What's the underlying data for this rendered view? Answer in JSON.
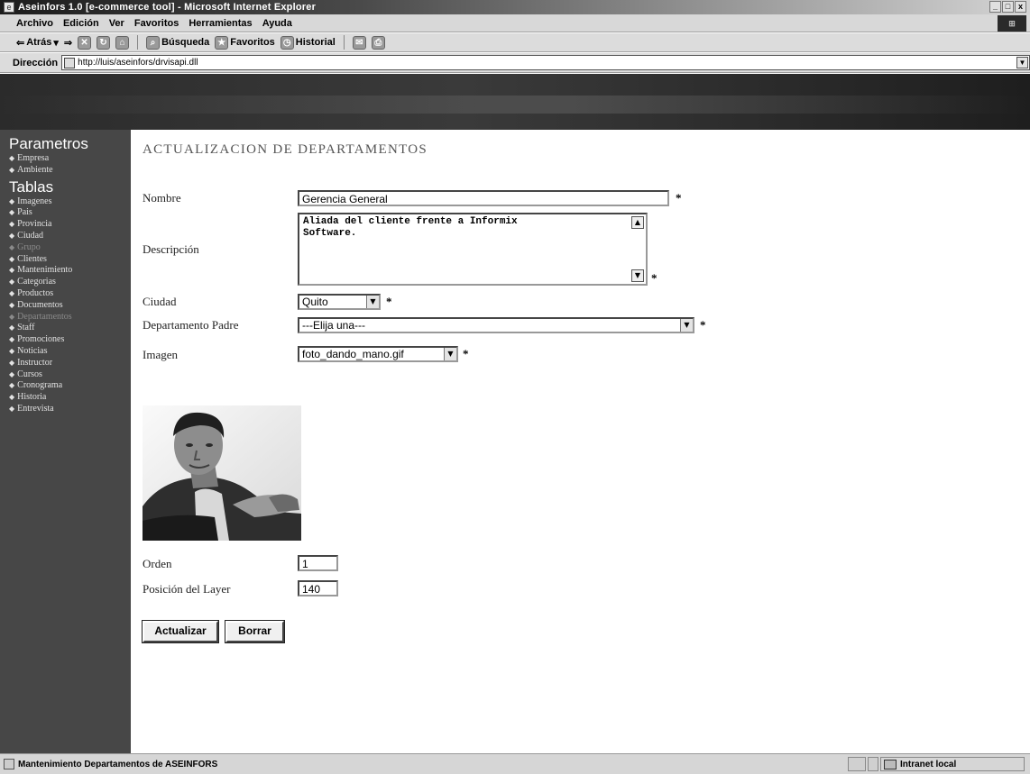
{
  "window": {
    "title": "Aseinfors 1.0 [e-commerce tool] - Microsoft Internet Explorer",
    "min_glyph": "_",
    "max_glyph": "□",
    "close_glyph": "x"
  },
  "menubar": {
    "items": [
      "Archivo",
      "Edición",
      "Ver",
      "Favoritos",
      "Herramientas",
      "Ayuda"
    ]
  },
  "toolbar": {
    "back": "Atrás",
    "search": "Búsqueda",
    "favorites": "Favoritos",
    "history": "Historial"
  },
  "address": {
    "label": "Dirección",
    "url": "http://luis/aseinfors/drvisapi.dll"
  },
  "sidebar": {
    "sections": [
      {
        "title": "Parametros",
        "items": [
          {
            "label": "Empresa",
            "dim": false
          },
          {
            "label": "Ambiente",
            "dim": false
          }
        ]
      },
      {
        "title": "Tablas",
        "items": [
          {
            "label": "Imagenes",
            "dim": false
          },
          {
            "label": "Pais",
            "dim": false
          },
          {
            "label": "Provincia",
            "dim": false
          },
          {
            "label": "Ciudad",
            "dim": false
          },
          {
            "label": "Grupo",
            "dim": true
          },
          {
            "label": "Clientes",
            "dim": false
          },
          {
            "label": "Mantenimiento",
            "dim": false
          },
          {
            "label": "Categorias",
            "dim": false
          },
          {
            "label": "Productos",
            "dim": false
          },
          {
            "label": "Documentos",
            "dim": false
          },
          {
            "label": "Departamentos",
            "dim": true
          },
          {
            "label": "Staff",
            "dim": false
          },
          {
            "label": "Promociones",
            "dim": false
          },
          {
            "label": "Noticias",
            "dim": false
          },
          {
            "label": "Instructor",
            "dim": false
          },
          {
            "label": "Cursos",
            "dim": false
          },
          {
            "label": "Cronograma",
            "dim": false
          },
          {
            "label": "Historia",
            "dim": false
          },
          {
            "label": "Entrevista",
            "dim": false
          }
        ]
      }
    ]
  },
  "form": {
    "title": "ACTUALIZACION DE DEPARTAMENTOS",
    "required_mark": "*",
    "nombre": {
      "label": "Nombre",
      "value": "Gerencia General"
    },
    "descripcion": {
      "label": "Descripción",
      "value": "Aliada del cliente frente a Informix\nSoftware."
    },
    "ciudad": {
      "label": "Ciudad",
      "value": "Quito"
    },
    "departamento_padre": {
      "label": "Departamento Padre",
      "value": "---Elija una---"
    },
    "imagen": {
      "label": "Imagen",
      "value": "foto_dando_mano.gif"
    },
    "orden": {
      "label": "Orden",
      "value": "1"
    },
    "posicion_layer": {
      "label": "Posición del Layer",
      "value": "140"
    },
    "buttons": {
      "update": "Actualizar",
      "delete": "Borrar"
    }
  },
  "statusbar": {
    "text": "Mantenimiento Departamentos de ASEINFORS",
    "zone": "Intranet local"
  }
}
